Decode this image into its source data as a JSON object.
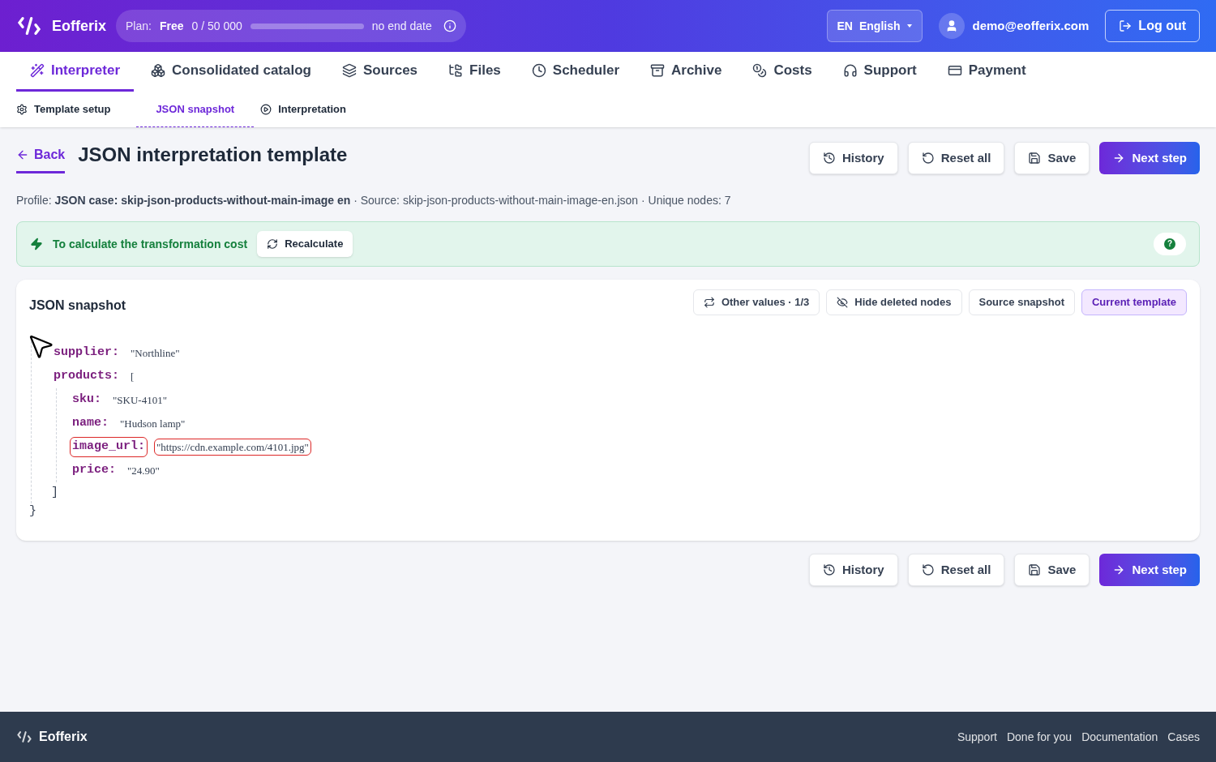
{
  "header": {
    "brand": "Eofferix",
    "plan": {
      "label": "Plan:",
      "name": "Free",
      "usage": "0 / 50 000",
      "level": 0,
      "end": "no end date"
    },
    "language": {
      "code": "EN",
      "name": "English"
    },
    "user": "demo@eofferix.com",
    "logout": "Log out"
  },
  "nav": [
    {
      "label": "Interpreter",
      "selected": true
    },
    {
      "label": "Consolidated catalog",
      "selected": false
    },
    {
      "label": "Sources",
      "selected": false
    },
    {
      "label": "Files",
      "selected": false
    },
    {
      "label": "Scheduler",
      "selected": false
    },
    {
      "label": "Archive",
      "selected": false
    },
    {
      "label": "Costs",
      "selected": false
    },
    {
      "label": "Support",
      "selected": false
    },
    {
      "label": "Payment",
      "selected": false
    }
  ],
  "subnav": [
    {
      "label": "Template setup",
      "selected": false
    },
    {
      "label": "JSON snapshot",
      "selected": true
    },
    {
      "label": "Interpretation",
      "selected": false
    }
  ],
  "back": "Back",
  "title": "JSON interpretation template",
  "actions_top": [
    {
      "label": "History",
      "kind": "history"
    },
    {
      "label": "Reset all",
      "kind": "reset"
    },
    {
      "label": "Save",
      "kind": "save"
    },
    {
      "label": "Next step",
      "kind": "next"
    }
  ],
  "actions_bottom": [
    {
      "label": "History",
      "kind": "history"
    },
    {
      "label": "Reset all",
      "kind": "reset"
    },
    {
      "label": "Save",
      "kind": "save"
    },
    {
      "label": "Next step",
      "kind": "next"
    }
  ],
  "profile_line": "Profile: **JSON case: skip-json-products-without-main-image en** · Source: skip-json-products-without-main-image-en.json · Unique nodes: 7",
  "notice": {
    "text": "To calculate the transformation cost",
    "button": "Recalculate",
    "help": "?"
  },
  "snapshot": {
    "title": "JSON snapshot",
    "toggles": [
      {
        "label": "Other values · 1/3",
        "selected": false
      },
      {
        "label": "Hide deleted nodes",
        "selected": false
      },
      {
        "label": "Source snapshot",
        "selected": false
      },
      {
        "label": "Current template",
        "selected": true
      }
    ],
    "nodes": [
      {
        "key": "supplier:",
        "value": "\"Northline\"",
        "highlighted": false
      },
      {
        "key": "products:",
        "value": "[",
        "highlighted": false,
        "close": "]",
        "children": [
          {
            "key": "sku:",
            "value": "\"SKU-4101\"",
            "highlighted": false
          },
          {
            "key": "name:",
            "value": "\"Hudson lamp\"",
            "highlighted": false
          },
          {
            "key": "image_url:",
            "value": "\"https://cdn.example.com/4101.jpg\"",
            "highlighted": true
          },
          {
            "key": "price:",
            "value": "\"24.90\"",
            "highlighted": false
          }
        ]
      }
    ],
    "close": "}"
  },
  "footer": {
    "brand": "Eofferix",
    "links": [
      "Support",
      "Done for you",
      "Documentation",
      "Cases"
    ]
  }
}
